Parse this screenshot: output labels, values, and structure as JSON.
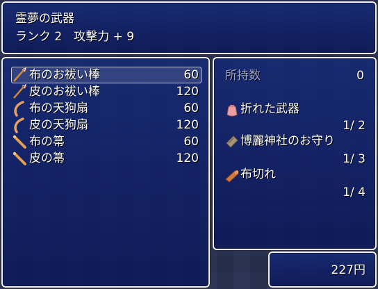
{
  "help": {
    "line1": "霊夢の武器",
    "line2": "ランク 2　攻撃力 + 9"
  },
  "items": [
    {
      "name": "布のお祓い棒",
      "price": "60",
      "icon": "gohei-wand-icon",
      "selected": true
    },
    {
      "name": "皮のお祓い棒",
      "price": "120",
      "icon": "gohei-wand-icon",
      "selected": false
    },
    {
      "name": "布の天狗扇",
      "price": "60",
      "icon": "tengu-fan-icon",
      "selected": false
    },
    {
      "name": "皮の天狗扇",
      "price": "120",
      "icon": "tengu-fan-icon",
      "selected": false
    },
    {
      "name": "布の箒",
      "price": "60",
      "icon": "broom-icon",
      "selected": false
    },
    {
      "name": "皮の箒",
      "price": "120",
      "icon": "broom-icon",
      "selected": false
    }
  ],
  "status": {
    "possession_label": "所持数",
    "possession_value": "0",
    "materials": [
      {
        "name": "折れた武器",
        "count": "1/ 2",
        "icon": "pouch-icon"
      },
      {
        "name": "博麗神社のお守り",
        "count": "1/ 3",
        "icon": "scroll-icon"
      },
      {
        "name": "布切れ",
        "count": "1/ 4",
        "icon": "cloth-icon"
      }
    ]
  },
  "gold": {
    "amount": "227",
    "unit": "円"
  }
}
